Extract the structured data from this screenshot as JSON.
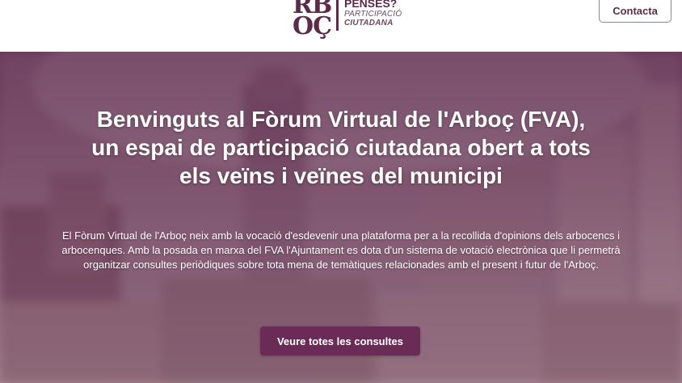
{
  "header": {
    "logo": {
      "mark_line1": "RB",
      "mark_line2": "OÇ",
      "line1": "PENSES?",
      "line2": "PARTICIPACIÓ",
      "line3": "CIUTADANA"
    },
    "contact_label": "Contacta"
  },
  "hero": {
    "title_lines": [
      "Benvinguts al Fòrum Virtual de l'Arboç (FVA),",
      "un espai de participació ciutadana obert a tots",
      "els veïns i veïnes del municipi"
    ],
    "description": "El Fòrum Virtual de l'Arboç neix amb la vocació d'esdevenir una plataforma per a la recollida d'opinions dels arbocencs i arbocenques. Amb la posada en marxa del FVA l'Ajuntament es dota d'un sistema de votació electrònica que li permetrà organitzar consultes periòdiques sobre tota mena de temàtiques relacionades amb el present i futur de l'Arboç.",
    "cta_label": "Veure totes les consultes"
  },
  "colors": {
    "brand": "#5c2b4a",
    "button": "#6a2c57",
    "hero_text": "#ffffff"
  }
}
